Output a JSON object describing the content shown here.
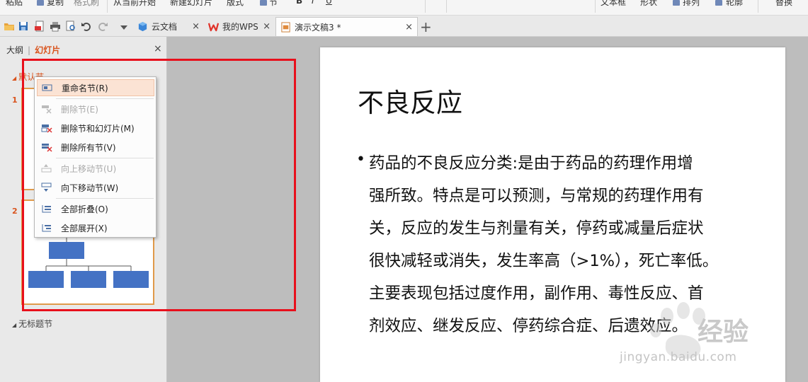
{
  "ribbon": {
    "items": [
      "粘贴",
      "复制",
      "格式刷",
      "从当前开始",
      "新建幻灯片",
      "版式",
      "节",
      "文本框",
      "形状",
      "排列",
      "轮廓",
      "替换"
    ]
  },
  "tabbar": {
    "tabs": [
      {
        "label": "云文档",
        "icon": "cloud-cube-icon"
      },
      {
        "label": "我的WPS",
        "icon": "wps-logo-icon"
      },
      {
        "label": "演示文稿3 *",
        "icon": "presentation-doc-icon"
      }
    ],
    "close_glyph": "×",
    "new_tab_glyph": "+"
  },
  "left_panel": {
    "tab_outline": "大纲",
    "tab_separator": "|",
    "tab_slides": "幻灯片",
    "close_glyph": "×",
    "section_default": "默认节",
    "section_untitled": "无标题节",
    "slide_numbers": [
      "1",
      "2"
    ]
  },
  "context_menu": {
    "items": [
      {
        "label": "重命名节(R)",
        "enabled": true,
        "icon": "rename-section-icon"
      },
      {
        "label": "删除节(E)",
        "enabled": false,
        "icon": "delete-section-icon"
      },
      {
        "label": "删除节和幻灯片(M)",
        "enabled": true,
        "icon": "delete-section-slides-icon"
      },
      {
        "label": "删除所有节(V)",
        "enabled": true,
        "icon": "delete-all-sections-icon"
      },
      {
        "label": "向上移动节(U)",
        "enabled": false,
        "icon": "move-section-up-icon"
      },
      {
        "label": "向下移动节(W)",
        "enabled": true,
        "icon": "move-section-down-icon"
      },
      {
        "label": "全部折叠(O)",
        "enabled": true,
        "icon": "collapse-all-icon"
      },
      {
        "label": "全部展开(X)",
        "enabled": true,
        "icon": "expand-all-icon"
      }
    ]
  },
  "slide": {
    "title": "不良反应",
    "bullet_glyph": "•",
    "body_lines": [
      "药品的不良反应分类:是由于药品的药理作用增",
      "强所致。特点是可以预测，与常规的药理作用有",
      "关，反应的发生与剂量有关，停药或减量后症状",
      "很快减轻或消失，发生率高（>1%），死亡率低。",
      "主要表现包括过度作用，副作用、毒性反应、首",
      "剂效应、继发反应、停药综合症、后遗效应。"
    ]
  },
  "watermark": {
    "text": "经验",
    "url": "jingyan.baidu.com"
  },
  "colors": {
    "accent_orange": "#d9541e",
    "highlight_red": "#e8101c",
    "diagram_blue": "#4472c4"
  }
}
